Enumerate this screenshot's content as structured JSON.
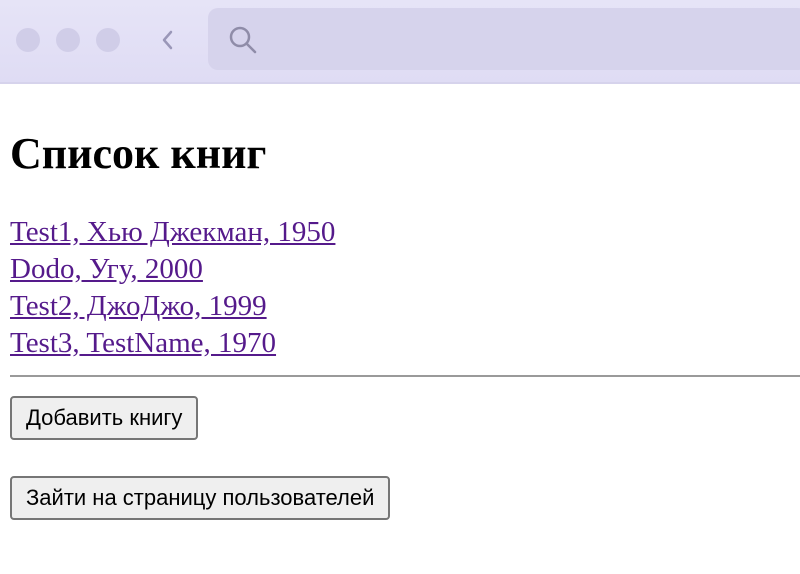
{
  "browser": {
    "icons": {
      "back": "chevron-left-icon",
      "search": "search-icon"
    }
  },
  "page": {
    "title": "Список книг",
    "books": [
      {
        "label": "Test1, Хью Джекман, 1950"
      },
      {
        "label": "Dodo, Угу, 2000"
      },
      {
        "label": "Test2, ДжоДжо, 1999"
      },
      {
        "label": "Test3, TestName, 1970"
      }
    ],
    "add_book_label": "Добавить книгу",
    "users_page_label": "Зайти на страницу пользователей"
  },
  "colors": {
    "link_visited": "#551a8b",
    "chrome_bg": "#e6e4f7"
  }
}
